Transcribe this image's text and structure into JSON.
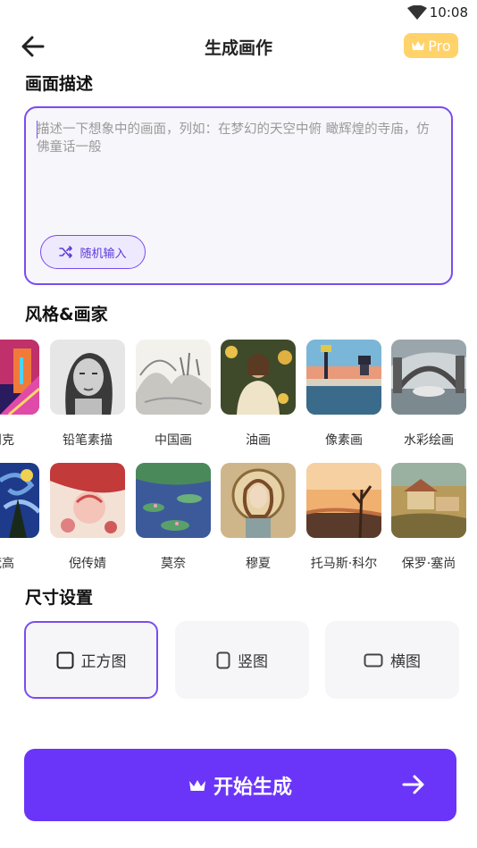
{
  "status_bar": {
    "time": "10:08"
  },
  "header": {
    "title": "生成画作",
    "pro_label": "Pro"
  },
  "description": {
    "section_title": "画面描述",
    "placeholder": "描述一下想象中的画面，列如：在梦幻的天空中俯 瞰辉煌的寺庙，仿佛童话一般",
    "random_button": "随机输入"
  },
  "styles": {
    "section_title": "风格&画家",
    "row1": [
      "朋克",
      "铅笔素描",
      "中国画",
      "油画",
      "像素画",
      "水彩绘画"
    ],
    "row2": [
      "梵高",
      "倪传婧",
      "莫奈",
      "穆夏",
      "托马斯·科尔",
      "保罗·塞尚"
    ]
  },
  "size": {
    "section_title": "尺寸设置",
    "options": [
      "正方图",
      "竖图",
      "横图"
    ],
    "selected": "正方图"
  },
  "start_button": {
    "label": "开始生成"
  },
  "colors": {
    "accent": "#6a35f8",
    "border_accent": "#7a4cf0",
    "pro_gold": "#ffd36a"
  }
}
